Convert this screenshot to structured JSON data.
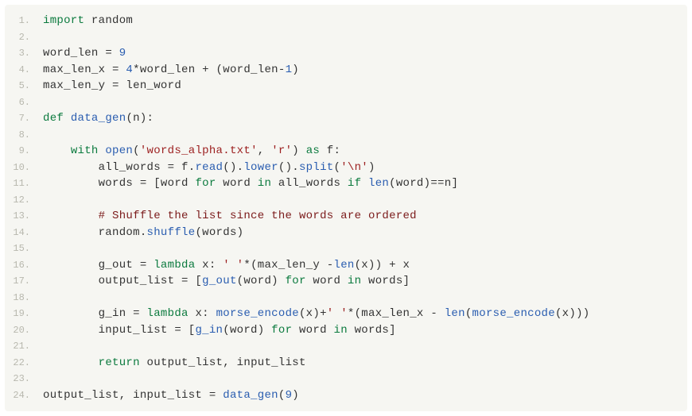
{
  "lines": [
    {
      "n": "1.",
      "tokens": [
        {
          "t": "import",
          "c": "kw"
        },
        {
          "t": " random",
          "c": "ident"
        }
      ]
    },
    {
      "n": "2.",
      "tokens": []
    },
    {
      "n": "3.",
      "tokens": [
        {
          "t": "word_len ",
          "c": "ident"
        },
        {
          "t": "=",
          "c": "op"
        },
        {
          "t": " ",
          "c": "ident"
        },
        {
          "t": "9",
          "c": "num"
        }
      ]
    },
    {
      "n": "4.",
      "tokens": [
        {
          "t": "max_len_x ",
          "c": "ident"
        },
        {
          "t": "=",
          "c": "op"
        },
        {
          "t": " ",
          "c": "ident"
        },
        {
          "t": "4",
          "c": "num"
        },
        {
          "t": "*",
          "c": "op"
        },
        {
          "t": "word_len ",
          "c": "ident"
        },
        {
          "t": "+",
          "c": "op"
        },
        {
          "t": " (word_len",
          "c": "ident"
        },
        {
          "t": "-",
          "c": "op"
        },
        {
          "t": "1",
          "c": "num"
        },
        {
          "t": ")",
          "c": "ident"
        }
      ]
    },
    {
      "n": "5.",
      "tokens": [
        {
          "t": "max_len_y ",
          "c": "ident"
        },
        {
          "t": "=",
          "c": "op"
        },
        {
          "t": " len_word",
          "c": "ident"
        }
      ]
    },
    {
      "n": "6.",
      "tokens": []
    },
    {
      "n": "7.",
      "tokens": [
        {
          "t": "def",
          "c": "kw"
        },
        {
          "t": " ",
          "c": "ident"
        },
        {
          "t": "data_gen",
          "c": "func"
        },
        {
          "t": "(n):",
          "c": "ident"
        }
      ]
    },
    {
      "n": "8.",
      "tokens": []
    },
    {
      "n": "9.",
      "tokens": [
        {
          "t": "    ",
          "c": "ident"
        },
        {
          "t": "with",
          "c": "kw"
        },
        {
          "t": " ",
          "c": "ident"
        },
        {
          "t": "open",
          "c": "builtin"
        },
        {
          "t": "(",
          "c": "ident"
        },
        {
          "t": "'words_alpha.txt'",
          "c": "str"
        },
        {
          "t": ", ",
          "c": "ident"
        },
        {
          "t": "'r'",
          "c": "str"
        },
        {
          "t": ") ",
          "c": "ident"
        },
        {
          "t": "as",
          "c": "kw"
        },
        {
          "t": " f:",
          "c": "ident"
        }
      ]
    },
    {
      "n": "10.",
      "tokens": [
        {
          "t": "        all_words ",
          "c": "ident"
        },
        {
          "t": "=",
          "c": "op"
        },
        {
          "t": " f.",
          "c": "ident"
        },
        {
          "t": "read",
          "c": "func"
        },
        {
          "t": "().",
          "c": "ident"
        },
        {
          "t": "lower",
          "c": "func"
        },
        {
          "t": "().",
          "c": "ident"
        },
        {
          "t": "split",
          "c": "func"
        },
        {
          "t": "(",
          "c": "ident"
        },
        {
          "t": "'\\n'",
          "c": "str"
        },
        {
          "t": ")",
          "c": "ident"
        }
      ]
    },
    {
      "n": "11.",
      "tokens": [
        {
          "t": "        words ",
          "c": "ident"
        },
        {
          "t": "=",
          "c": "op"
        },
        {
          "t": " [word ",
          "c": "ident"
        },
        {
          "t": "for",
          "c": "kw"
        },
        {
          "t": " word ",
          "c": "ident"
        },
        {
          "t": "in",
          "c": "kw"
        },
        {
          "t": " all_words ",
          "c": "ident"
        },
        {
          "t": "if",
          "c": "kw"
        },
        {
          "t": " ",
          "c": "ident"
        },
        {
          "t": "len",
          "c": "builtin"
        },
        {
          "t": "(word)",
          "c": "ident"
        },
        {
          "t": "==",
          "c": "op"
        },
        {
          "t": "n]",
          "c": "ident"
        }
      ]
    },
    {
      "n": "12.",
      "tokens": []
    },
    {
      "n": "13.",
      "tokens": [
        {
          "t": "        ",
          "c": "ident"
        },
        {
          "t": "# Shuffle the list since the words are ordered",
          "c": "cmt"
        }
      ]
    },
    {
      "n": "14.",
      "tokens": [
        {
          "t": "        random.",
          "c": "ident"
        },
        {
          "t": "shuffle",
          "c": "func"
        },
        {
          "t": "(words)",
          "c": "ident"
        }
      ]
    },
    {
      "n": "15.",
      "tokens": []
    },
    {
      "n": "16.",
      "tokens": [
        {
          "t": "        g_out ",
          "c": "ident"
        },
        {
          "t": "=",
          "c": "op"
        },
        {
          "t": " ",
          "c": "ident"
        },
        {
          "t": "lambda",
          "c": "kw"
        },
        {
          "t": " x: ",
          "c": "ident"
        },
        {
          "t": "' '",
          "c": "str"
        },
        {
          "t": "*",
          "c": "op"
        },
        {
          "t": "(max_len_y ",
          "c": "ident"
        },
        {
          "t": "-",
          "c": "op"
        },
        {
          "t": "len",
          "c": "builtin"
        },
        {
          "t": "(x)) ",
          "c": "ident"
        },
        {
          "t": "+",
          "c": "op"
        },
        {
          "t": " x",
          "c": "ident"
        }
      ]
    },
    {
      "n": "17.",
      "tokens": [
        {
          "t": "        output_list ",
          "c": "ident"
        },
        {
          "t": "=",
          "c": "op"
        },
        {
          "t": " [",
          "c": "ident"
        },
        {
          "t": "g_out",
          "c": "func"
        },
        {
          "t": "(word) ",
          "c": "ident"
        },
        {
          "t": "for",
          "c": "kw"
        },
        {
          "t": " word ",
          "c": "ident"
        },
        {
          "t": "in",
          "c": "kw"
        },
        {
          "t": " words]",
          "c": "ident"
        }
      ]
    },
    {
      "n": "18.",
      "tokens": []
    },
    {
      "n": "19.",
      "tokens": [
        {
          "t": "        g_in ",
          "c": "ident"
        },
        {
          "t": "=",
          "c": "op"
        },
        {
          "t": " ",
          "c": "ident"
        },
        {
          "t": "lambda",
          "c": "kw"
        },
        {
          "t": " x: ",
          "c": "ident"
        },
        {
          "t": "morse_encode",
          "c": "func"
        },
        {
          "t": "(x)",
          "c": "ident"
        },
        {
          "t": "+",
          "c": "op"
        },
        {
          "t": "' '",
          "c": "str"
        },
        {
          "t": "*",
          "c": "op"
        },
        {
          "t": "(max_len_x ",
          "c": "ident"
        },
        {
          "t": "-",
          "c": "op"
        },
        {
          "t": " ",
          "c": "ident"
        },
        {
          "t": "len",
          "c": "builtin"
        },
        {
          "t": "(",
          "c": "ident"
        },
        {
          "t": "morse_encode",
          "c": "func"
        },
        {
          "t": "(x)))",
          "c": "ident"
        }
      ]
    },
    {
      "n": "20.",
      "tokens": [
        {
          "t": "        input_list ",
          "c": "ident"
        },
        {
          "t": "=",
          "c": "op"
        },
        {
          "t": " [",
          "c": "ident"
        },
        {
          "t": "g_in",
          "c": "func"
        },
        {
          "t": "(word) ",
          "c": "ident"
        },
        {
          "t": "for",
          "c": "kw"
        },
        {
          "t": " word ",
          "c": "ident"
        },
        {
          "t": "in",
          "c": "kw"
        },
        {
          "t": " words]",
          "c": "ident"
        }
      ]
    },
    {
      "n": "21.",
      "tokens": []
    },
    {
      "n": "22.",
      "tokens": [
        {
          "t": "        ",
          "c": "ident"
        },
        {
          "t": "return",
          "c": "kw"
        },
        {
          "t": " output_list, input_list",
          "c": "ident"
        }
      ]
    },
    {
      "n": "23.",
      "tokens": []
    },
    {
      "n": "24.",
      "tokens": [
        {
          "t": "output_list, input_list ",
          "c": "ident"
        },
        {
          "t": "=",
          "c": "op"
        },
        {
          "t": " ",
          "c": "ident"
        },
        {
          "t": "data_gen",
          "c": "func"
        },
        {
          "t": "(",
          "c": "ident"
        },
        {
          "t": "9",
          "c": "num"
        },
        {
          "t": ")",
          "c": "ident"
        }
      ]
    }
  ]
}
